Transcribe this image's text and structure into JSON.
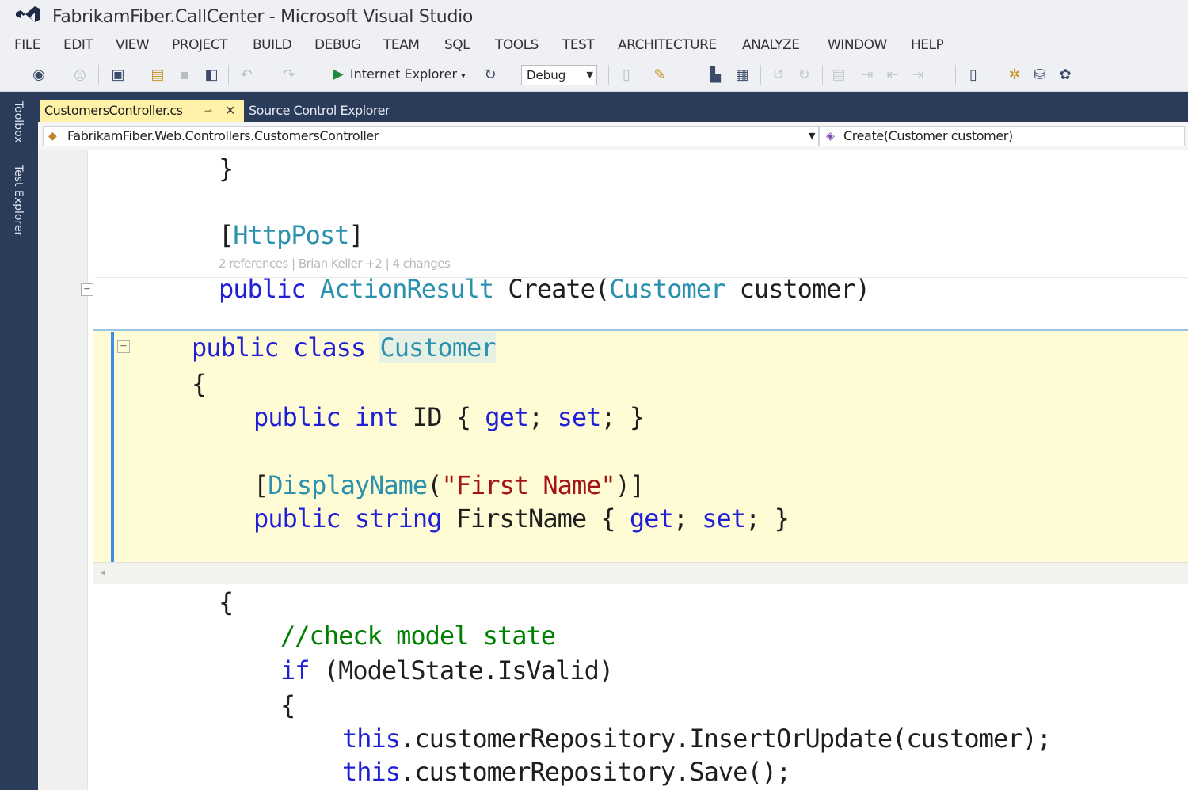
{
  "window": {
    "title": "FabrikamFiber.CallCenter - Microsoft Visual Studio"
  },
  "menu": [
    "FILE",
    "EDIT",
    "VIEW",
    "PROJECT",
    "BUILD",
    "DEBUG",
    "TEAM",
    "SQL",
    "TOOLS",
    "TEST",
    "ARCHITECTURE",
    "ANALYZE",
    "WINDOW",
    "HELP"
  ],
  "toolbar": {
    "run_target": "Internet Explorer",
    "configuration": "Debug"
  },
  "side_tabs": [
    "Toolbox",
    "Test Explorer"
  ],
  "tabs": {
    "active": "CustomersController.cs",
    "other": "Source Control Explorer"
  },
  "navbar": {
    "type_path": "FabrikamFiber.Web.Controllers.CustomersController",
    "member": "Create(Customer customer)"
  },
  "codelens": "2 references | Brian Keller +2 | 4 changes",
  "code": {
    "l1": "}",
    "attr_open": "[",
    "attr_name": "HttpPost",
    "attr_close": "]",
    "sig_public": "public",
    "sig_type": "ActionResult",
    "sig_method": "Create(",
    "sig_param_type": "Customer",
    "sig_param": "customer)",
    "peek_public": "public",
    "peek_class": "class",
    "peek_name": "Customer",
    "peek_open": "{",
    "p1_public": "public",
    "p1_int": "int",
    "p1_id": "ID { ",
    "p1_get": "get",
    "p1_semi": "; ",
    "p1_set": "set",
    "p1_end": "; }",
    "dn_open": "[",
    "dn_name": "DisplayName",
    "dn_paren": "(",
    "dn_str": "\"First Name\"",
    "dn_close": ")]",
    "p2_public": "public",
    "p2_string": "string",
    "p2_name": "FirstName { ",
    "p2_get": "get",
    "p2_semi": "; ",
    "p2_set": "set",
    "p2_end": "; }",
    "body_open": "{",
    "comment": "//check model state",
    "if_kw": "if",
    "if_cond": " (ModelState.IsValid)",
    "inner_open": "{",
    "this1": "this",
    "call1": ".customerRepository.InsertOrUpdate(customer);",
    "this2": "this",
    "call2": ".customerRepository.Save();"
  },
  "colors": {
    "keyword": "#1f1fd6",
    "type": "#2b91af",
    "string": "#a31515",
    "comment": "#008000",
    "chrome_dark": "#2b3b5a",
    "active_tab": "#fff1a8",
    "peek_background": "#fffbd4"
  }
}
